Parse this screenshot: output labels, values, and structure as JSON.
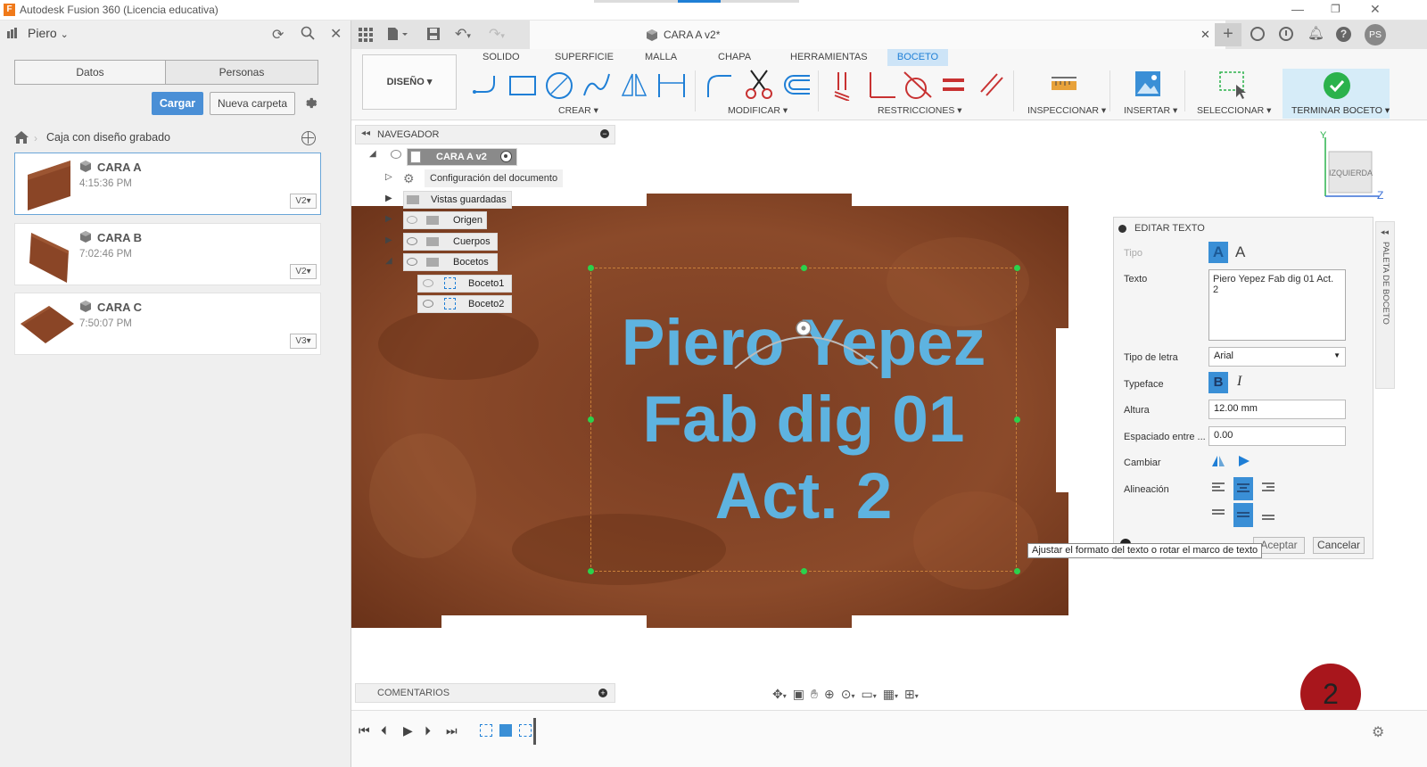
{
  "window": {
    "title": "Autodesk Fusion 360 (Licencia educativa)"
  },
  "left": {
    "user": "Piero",
    "tabs": [
      "Datos",
      "Personas"
    ],
    "upload_label": "Cargar",
    "new_folder_label": "Nueva carpeta",
    "breadcrumb": "Caja con diseño grabado",
    "files": [
      {
        "name": "CARA A",
        "time": "4:15:36 PM",
        "version": "V2▾"
      },
      {
        "name": "CARA B",
        "time": "7:02:46 PM",
        "version": "V2▾"
      },
      {
        "name": "CARA C",
        "time": "7:50:07 PM",
        "version": "V3▾"
      }
    ]
  },
  "doc_tab": {
    "title": "CARA A v2*"
  },
  "user_initials": "PS",
  "ribbon": {
    "workspace": "DISEÑO ▾",
    "tabs": [
      "SOLIDO",
      "SUPERFICIE",
      "MALLA",
      "CHAPA",
      "HERRAMIENTAS",
      "BOCETO"
    ],
    "groups": {
      "crear": "CREAR ▾",
      "modificar": "MODIFICAR ▾",
      "restricciones": "RESTRICCIONES ▾",
      "inspeccionar": "INSPECCIONAR ▾",
      "insertar": "INSERTAR ▾",
      "seleccionar": "SELECCIONAR ▾",
      "terminar": "TERMINAR BOCETO ▾"
    },
    "colors": {
      "active_tab": "#1f7fd6",
      "finish_check": "#2bb24c"
    }
  },
  "navigator": {
    "title": "NAVEGADOR",
    "root": "CARA A v2",
    "items": [
      "Configuración del documento",
      "Vistas guardadas",
      "Origen",
      "Cuerpos",
      "Bocetos",
      "Boceto1",
      "Boceto2"
    ]
  },
  "sketch_text": {
    "line1": "Piero Yepez",
    "line2": "Fab dig 01",
    "line3": "Act. 2",
    "color": "#5eb3e0"
  },
  "viewcube": {
    "face": "IZQUIERDA",
    "axis_y": "Y",
    "axis_z": "Z"
  },
  "edit_text": {
    "title": "EDITAR TEXTO",
    "tipo_label": "Tipo",
    "texto_label": "Texto",
    "texto_value": "Piero Yepez Fab dig 01 Act. 2",
    "font_label": "Tipo de letra",
    "font_value": "Arial",
    "typeface_label": "Typeface",
    "bold": "B",
    "italic": "I",
    "height_label": "Altura",
    "height_value": "12.00 mm",
    "spacing_label": "Espaciado entre ...",
    "spacing_value": "0.00",
    "flip_label": "Cambiar",
    "align_label": "Alineación",
    "ok_label": "Aceptar",
    "cancel_label": "Cancelar"
  },
  "tooltip": "Ajustar el formato del texto o rotar el marco de texto",
  "palette_tab": "PALETA DE BOCETO",
  "comments": "COMENTARIOS",
  "badge": "2"
}
